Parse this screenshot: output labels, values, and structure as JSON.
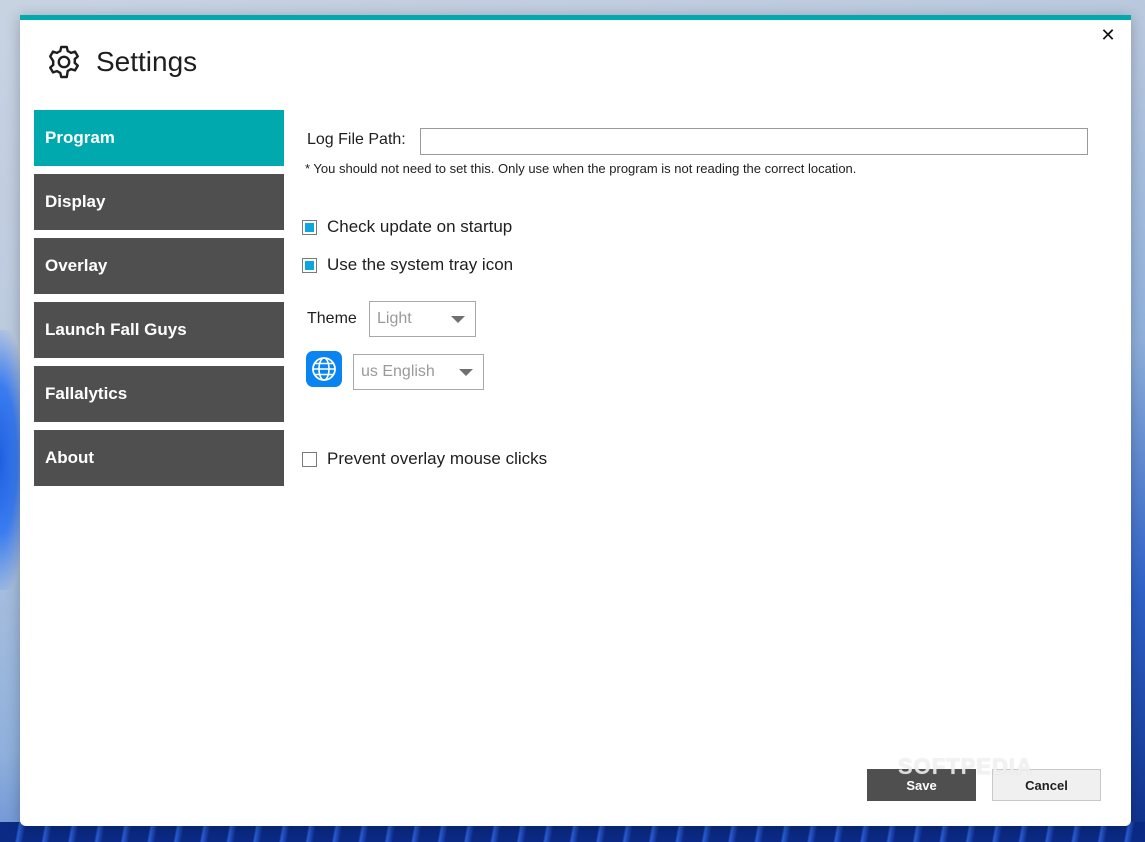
{
  "window": {
    "title": "Settings",
    "close_glyph": "✕",
    "accent_color": "#00a9ad"
  },
  "sidebar": {
    "items": [
      {
        "label": "Program",
        "active": true
      },
      {
        "label": "Display",
        "active": false
      },
      {
        "label": "Overlay",
        "active": false
      },
      {
        "label": "Launch Fall Guys",
        "active": false
      },
      {
        "label": "Fallalytics",
        "active": false
      },
      {
        "label": "About",
        "active": false
      }
    ]
  },
  "program": {
    "log_file_label": "Log File Path:",
    "log_file_value": "",
    "log_file_note": "* You should not need to set this. Only use when the program is not reading the correct location.",
    "check_update_label": "Check update on startup",
    "check_update_checked": true,
    "tray_icon_label": "Use the system tray icon",
    "tray_icon_checked": true,
    "theme_label": "Theme",
    "theme_value": "Light",
    "language_value": "us English",
    "prevent_clicks_label": "Prevent overlay mouse clicks",
    "prevent_clicks_checked": false
  },
  "footer": {
    "save_label": "Save",
    "cancel_label": "Cancel"
  },
  "watermark": "SOFTPEDIA",
  "icons": [
    "gear-icon",
    "close-icon",
    "globe-icon",
    "chevron-down-icon"
  ]
}
